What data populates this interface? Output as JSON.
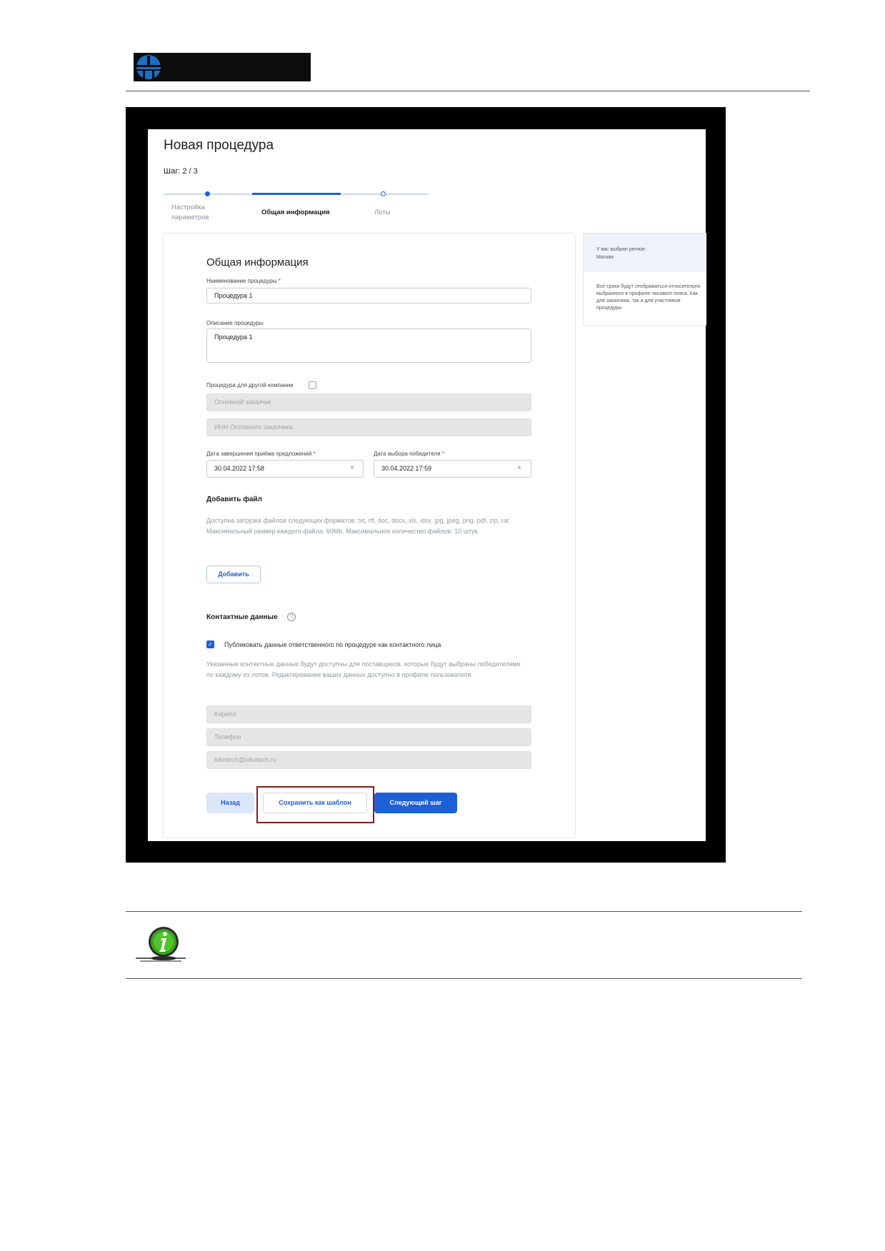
{
  "header": {
    "logo": "company-logo"
  },
  "form": {
    "title": "Новая процедура",
    "step": "Шаг: 2 / 3",
    "stepper": [
      {
        "label": "Настройка\nпараметров"
      },
      {
        "label": "Общая информация"
      },
      {
        "label": "Лоты"
      }
    ],
    "section_title": "Общая информация",
    "name_label": "Наименование процедуры",
    "required_mark": "*",
    "name_value": "Процедура 1",
    "desc_label": "Описание процедуры",
    "desc_value": "Процедура 1",
    "other_company_label": "Процедура для другой компании",
    "main_customer_placeholder": "Основной заказчик",
    "inn_placeholder": "ИНН Основного заказчика",
    "end_date_label": "Дата завершения приёма предложений",
    "end_date_value": "30.04.2022 17:58",
    "winner_date_label": "Дата выбора победителя",
    "winner_date_value": "30.04.2022 17:59",
    "clear_glyph": "×",
    "add_file_title": "Добавить файл",
    "file_info": "Доступна загрузка файлов следующих форматов: txt, rtf, doc, docx, xls, xlsx, jpg, jpeg, png, pdf, zip, rar. Максимальный размер каждого файла: 60Mb. Максимальное количество файлов: 10 штук.",
    "add_button": "Добавить",
    "contacts_title": "Контактные данные",
    "help_glyph": "?",
    "publish_label": "Публиковать данные ответственного по процедуре как контактного лица",
    "check_glyph": "✓",
    "contacts_info": "Указанные контактные данные будут доступны для поставщиков, которые будут выбраны победителями по каждому из лотов. Редактирование ваших данных доступно в профиле пользователя.",
    "contact_name": "Кирилл",
    "phone_placeholder": "Телефон",
    "email": "lokotech@lokotech.ru",
    "back_button": "Назад",
    "save_template_button": "Сохранить как шаблон",
    "next_button": "Следующий шаг"
  },
  "sidebar": {
    "region_title": "У вас выбран регион:",
    "region_value": "Москва",
    "timezone_note": "Все сроки будут отображаться относительно выбранного в профиле часового пояса. Как для заказчика, так и для участников процедуры"
  },
  "colors": {
    "accent": "#1d5fd6",
    "highlight": "#8b1a1a",
    "note_icon": "#3aa31d"
  },
  "note": {
    "icon": "info-icon"
  }
}
